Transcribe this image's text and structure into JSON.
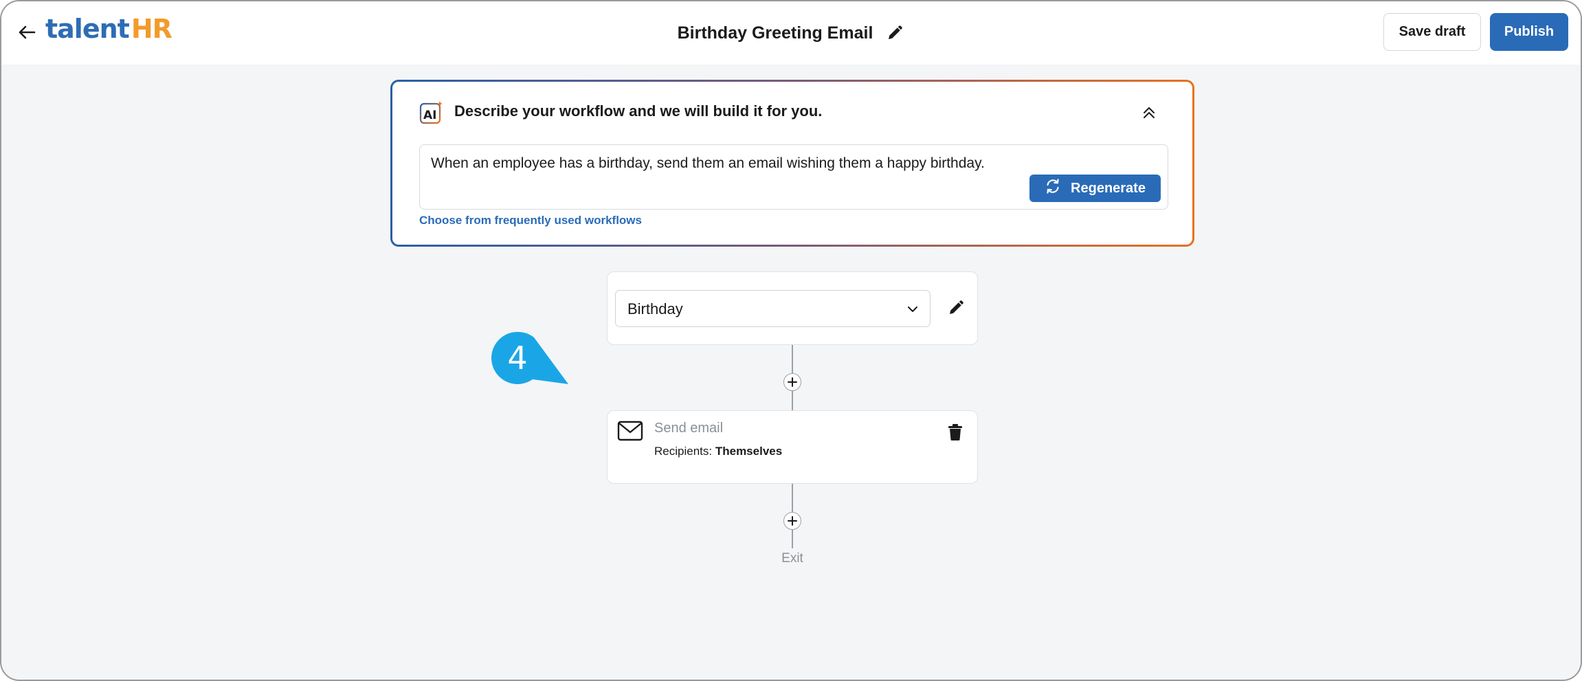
{
  "header": {
    "back_icon": "arrow-left-icon",
    "logo": {
      "part1": "talent",
      "part2": "HR"
    },
    "title": "Birthday Greeting Email",
    "title_edit_icon": "pencil-icon",
    "save_draft_label": "Save draft",
    "publish_label": "Publish"
  },
  "ai_panel": {
    "badge_text": "AI",
    "heading": "Describe your workflow and we will build it for you.",
    "collapse_icon": "chevron-double-up-icon",
    "prompt_text": "When an employee has a birthday, send them an email wishing them a happy birthday.",
    "regenerate_label": "Regenerate",
    "regenerate_icon": "refresh-icon",
    "frequent_link": "Choose from frequently used workflows"
  },
  "workflow": {
    "trigger": {
      "selected": "Birthday",
      "dropdown_icon": "chevron-down-icon",
      "edit_icon": "pencil-icon"
    },
    "action": {
      "title": "Send email",
      "recipients_label": "Recipients:",
      "recipients_value": "Themselves",
      "icon": "envelope-icon",
      "delete_icon": "trash-icon"
    },
    "exit_label": "Exit"
  },
  "step_marker": {
    "number": "4"
  },
  "colors": {
    "primary": "#2a6bb8",
    "brand_orange": "#f39a2b",
    "marker": "#1aa6e6",
    "background": "#f4f5f7"
  }
}
